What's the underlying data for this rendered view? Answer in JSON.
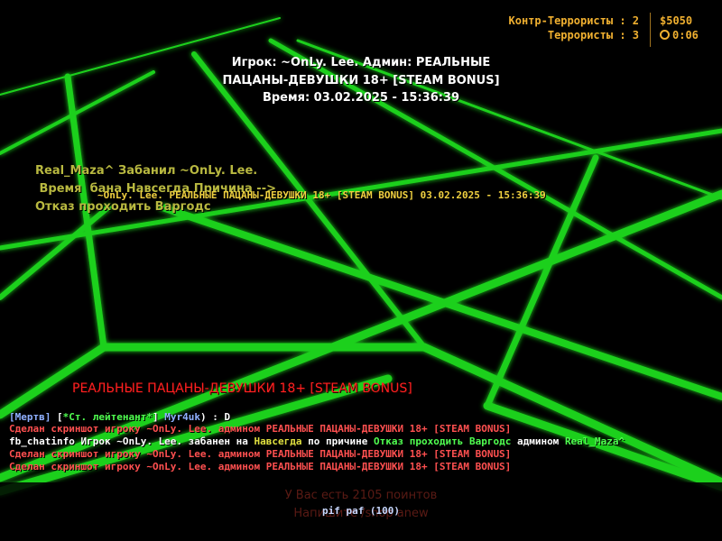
{
  "scoreboard": {
    "ct_label": "Контр-Террористы : 2",
    "t_label": "Террористы : 3",
    "money": "$5050",
    "timer": "0:06"
  },
  "header": {
    "line1": "Игрок: ~OnLy. Lee.  Админ: РЕАЛЬНЫЕ",
    "line2": "ПАЦАНЫ-ДЕВУШКИ 18+ [STEAM BONUS]",
    "line3": "Время: 03.02.2025 - 15:36:39"
  },
  "ban_notice": {
    "line1": "Real_Maza^ Забанил ~OnLy. Lee.",
    "line2": " Время  бана Навсегда Причина -->",
    "line3": "Отказ проходить Варгодс",
    "overlay": "~OnLy. Lee. РЕАЛЬНЫЕ ПАЦАНЫ-ДЕВУШКИ 18+ [STEAM BONUS] 03.02.2025 - 15:36:39"
  },
  "server_title": "РЕАЛЬНЫЕ ПАЦАНЫ-ДЕВУШКИ 18+ [STEAM BONUS]",
  "chat": {
    "line1": {
      "dead_tag": "[Мертв]",
      "rank_open": "[",
      "rank": "*Ст. лейтенант*",
      "rank_close": "]",
      "player": "Myr4uk",
      "message": ") : D"
    },
    "screenshot_prefix": "Сделан скриншот игроку ~OnLy. Lee. админом ",
    "screenshot_admin": "РЕАЛЬНЫЕ ПАЦАНЫ-ДЕВУШКИ 18+ [STEAM BONUS]",
    "fb_line": {
      "p1": "fb_chatinfo Игрок ~OnLy. Lee. забанен на ",
      "duration": "Навсегда",
      "p2": " по причине ",
      "reason": "Отказ проходить Варгодс",
      "p3": " админом ",
      "admin": "Real_Maza^"
    }
  },
  "bottom": {
    "points_text": "У Вас есть 2105 поинтов",
    "menu_hint": "Напишите /shop anew",
    "menu_entry": "pif paf (100)"
  },
  "colors": {
    "grid_green": "#22e022",
    "hud_orange": "#f0b030",
    "server_red": "#ff2020"
  }
}
